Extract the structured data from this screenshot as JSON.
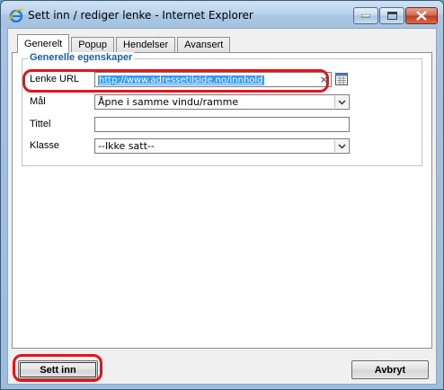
{
  "window": {
    "title": "Sett inn / rediger lenke - Internet Explorer"
  },
  "tabs": [
    {
      "label": "Generelt",
      "active": true
    },
    {
      "label": "Popup",
      "active": false
    },
    {
      "label": "Hendelser",
      "active": false
    },
    {
      "label": "Avansert",
      "active": false
    }
  ],
  "general": {
    "legend": "Generelle egenskaper",
    "url_label": "Lenke URL",
    "url_value": "http://www.adressetilside.no/innhold",
    "clear_glyph": "×",
    "target_label": "Mål",
    "target_value": "Åpne i samme vindu/ramme",
    "title_label": "Tittel",
    "title_value": "",
    "class_label": "Klasse",
    "class_value": "--Ikke satt--"
  },
  "buttons": {
    "insert": "Sett inn",
    "cancel": "Avbryt"
  },
  "colors": {
    "highlight": "#e8131a",
    "legend": "#1b5fa5",
    "selection": "#3399ff"
  },
  "icons": [
    "ie-logo-icon",
    "minimize-icon",
    "maximize-icon",
    "close-icon",
    "browse-list-icon",
    "chevron-down-icon"
  ]
}
